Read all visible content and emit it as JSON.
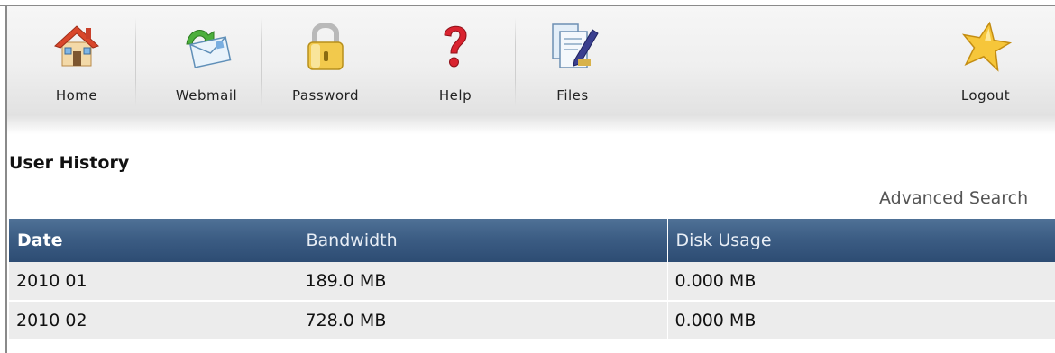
{
  "toolbar": {
    "items": [
      {
        "label": "Home",
        "icon": "home-icon"
      },
      {
        "label": "Webmail",
        "icon": "webmail-icon"
      },
      {
        "label": "Password",
        "icon": "lock-icon"
      },
      {
        "label": "Help",
        "icon": "question-icon"
      },
      {
        "label": "Files",
        "icon": "files-icon"
      },
      {
        "label": "Logout",
        "icon": "star-icon"
      }
    ]
  },
  "page": {
    "title": "User History",
    "advanced_search": "Advanced Search"
  },
  "table": {
    "headers": [
      "Date",
      "Bandwidth",
      "Disk Usage"
    ],
    "rows": [
      [
        "2010 01",
        "189.0 MB",
        "0.000 MB"
      ],
      [
        "2010 02",
        "728.0 MB",
        "0.000 MB"
      ]
    ]
  },
  "colors": {
    "header_bg": "#3c5d84",
    "row_bg": "#ececec",
    "frame": "#8a8a8a"
  }
}
